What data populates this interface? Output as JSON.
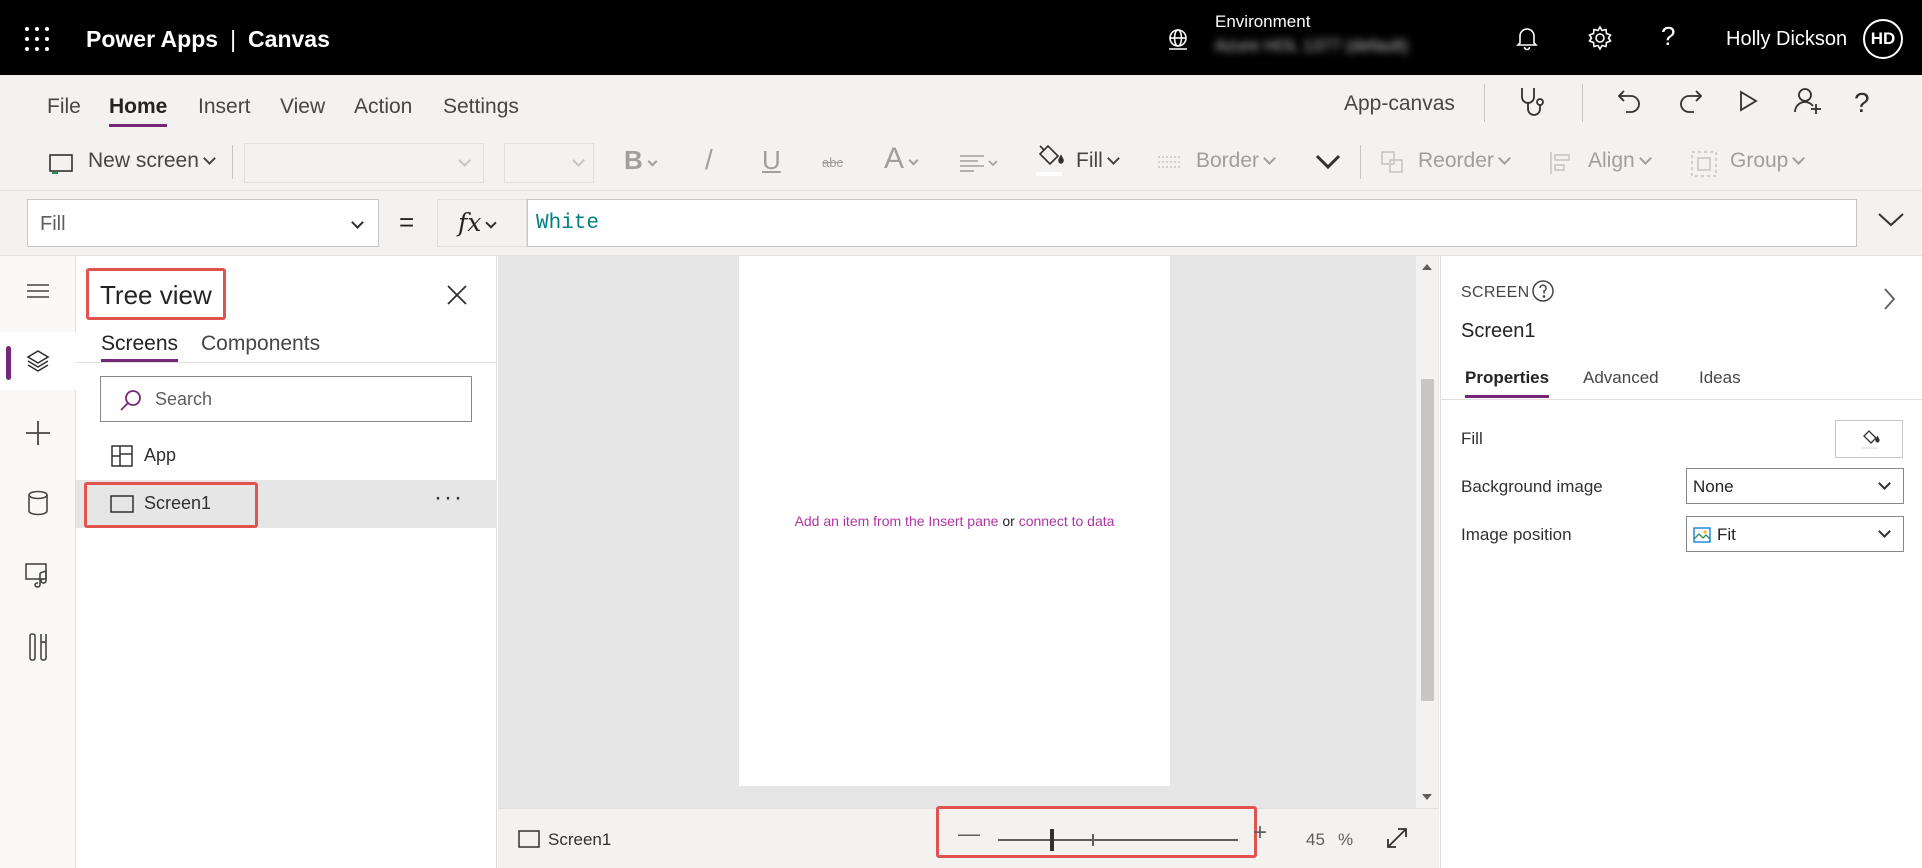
{
  "header": {
    "product": "Power Apps",
    "separator": "|",
    "app_type": "Canvas",
    "environment_label": "Environment",
    "environment_value": "Azure HOL 1377 (default)",
    "user_name": "Holly Dickson",
    "user_initials": "HD"
  },
  "menu": {
    "tabs": [
      "File",
      "Home",
      "Insert",
      "View",
      "Action",
      "Settings"
    ],
    "active_tab": "Home",
    "app_name": "App-canvas"
  },
  "ribbon": {
    "new_screen": "New screen",
    "bold": "B",
    "italic": "/",
    "underline": "U",
    "strikethrough": "abc",
    "font_color": "A",
    "fill": "Fill",
    "border": "Border",
    "reorder": "Reorder",
    "align": "Align",
    "group": "Group"
  },
  "formula_bar": {
    "property": "Fill",
    "equals": "=",
    "fx": "fx",
    "formula": "White"
  },
  "tree_view": {
    "title": "Tree view",
    "tabs": [
      "Screens",
      "Components"
    ],
    "search_placeholder": "Search",
    "items": [
      {
        "label": "App",
        "icon": "app-icon"
      },
      {
        "label": "Screen1",
        "icon": "screen-icon",
        "selected": true,
        "more": "···"
      }
    ]
  },
  "canvas": {
    "empty_prefix": "Add an item from the Insert pane",
    "empty_or": "or",
    "empty_link": "connect to data"
  },
  "status_bar": {
    "screen_name": "Screen1",
    "zoom_minus": "—",
    "zoom_plus": "+",
    "zoom_value": "45",
    "zoom_unit": "%",
    "zoom_level": 0.45
  },
  "properties": {
    "kind": "SCREEN",
    "name": "Screen1",
    "tabs": [
      "Properties",
      "Advanced",
      "Ideas"
    ],
    "active_tab": "Properties",
    "fill_label": "Fill",
    "background_image_label": "Background image",
    "background_image_value": "None",
    "image_position_label": "Image position",
    "image_position_value": "Fit"
  },
  "colors": {
    "accent": "#742774",
    "highlight": "#e0534f",
    "formula_text": "#008080",
    "link": "#b134a4"
  }
}
